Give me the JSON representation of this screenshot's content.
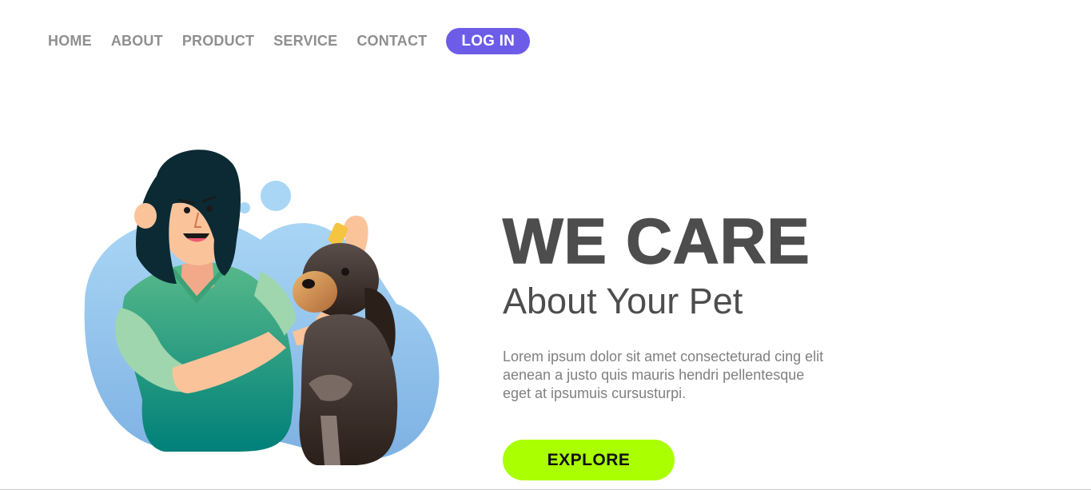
{
  "nav": {
    "items": [
      {
        "label": "HOME"
      },
      {
        "label": "ABOUT"
      },
      {
        "label": "PRODUCT"
      },
      {
        "label": "SERVICE"
      },
      {
        "label": "CONTACT"
      }
    ],
    "login_label": "LOG IN"
  },
  "hero": {
    "title": "WE CARE",
    "subtitle": "About Your Pet",
    "description": "Lorem ipsum dolor sit amet consecteturad cing elit aenean a justo quis mauris hendri pellentesque eget at ipsumuis cursusturpi.",
    "cta_label": "EXPLORE"
  },
  "colors": {
    "login_bg": "#6c5ce7",
    "cta_bg": "#aaff00",
    "nav_text": "#8f8f8f",
    "heading_text": "#4d4d4d",
    "body_text": "#808080"
  },
  "illustration": {
    "icon": "vet-with-dog-illustration"
  }
}
